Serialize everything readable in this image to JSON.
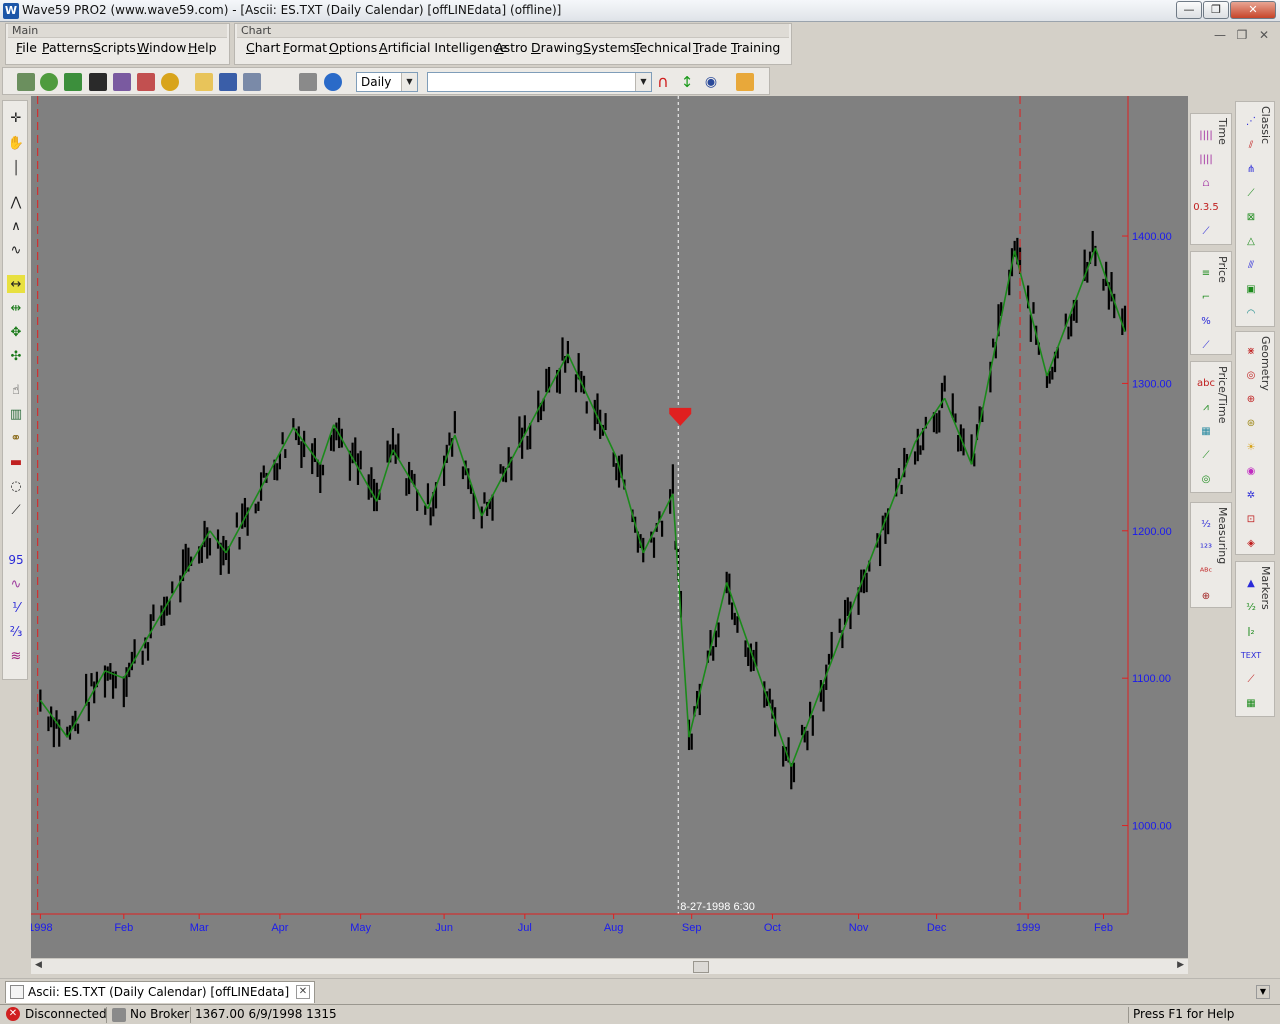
{
  "window": {
    "title": "Wave59 PRO2 (www.wave59.com) - [Ascii: ES.TXT (Daily Calendar) [offLINEdata] (offline)]",
    "app_icon": "W",
    "minimize": "—",
    "maximize": "❐",
    "close": "✕"
  },
  "main_menu": {
    "title": "Main",
    "items": [
      "File",
      "Patterns",
      "Scripts",
      "Window",
      "Help"
    ]
  },
  "chart_menu": {
    "title": "Chart",
    "items": [
      "Chart",
      "Format",
      "Options",
      "Artificial Intelligence",
      "Astro",
      "Drawing",
      "Systems",
      "Technical",
      "Trade",
      "Training"
    ]
  },
  "mdi_controls": {
    "minimize": "—",
    "restore": "❐",
    "close": "✕"
  },
  "toolbar": {
    "timeframe": "Daily",
    "symbol": ""
  },
  "chart_data": {
    "type": "bar",
    "x_tick_labels": [
      "1998",
      "Feb",
      "Mar",
      "Apr",
      "May",
      "Jun",
      "Jul",
      "Aug",
      "Sep",
      "Oct",
      "Nov",
      "Dec",
      "1999",
      "Feb"
    ],
    "y_tick_labels": [
      "1400.00",
      "1300.00",
      "1200.00",
      "1100.00",
      "1000.00"
    ],
    "y_ticks": [
      1400,
      1300,
      1200,
      1100,
      1000
    ],
    "ylim": [
      940,
      1495
    ],
    "crosshair_label": "8-27-1998 6:30",
    "zigzag": [
      [
        "1998-01-02",
        1085
      ],
      [
        "1998-01-12",
        1060
      ],
      [
        "1998-01-26",
        1105
      ],
      [
        "1998-02-02",
        1100
      ],
      [
        "1998-03-06",
        1200
      ],
      [
        "1998-03-12",
        1185
      ],
      [
        "1998-04-06",
        1270
      ],
      [
        "1998-04-16",
        1245
      ],
      [
        "1998-04-21",
        1272
      ],
      [
        "1998-05-07",
        1220
      ],
      [
        "1998-05-13",
        1255
      ],
      [
        "1998-05-26",
        1215
      ],
      [
        "1998-06-05",
        1265
      ],
      [
        "1998-06-15",
        1210
      ],
      [
        "1998-06-30",
        1262
      ],
      [
        "1998-07-17",
        1320
      ],
      [
        "1998-08-04",
        1250
      ],
      [
        "1998-08-14",
        1185
      ],
      [
        "1998-08-25",
        1225
      ],
      [
        "1998-08-31",
        1060
      ],
      [
        "1998-09-14",
        1165
      ],
      [
        "1998-10-08",
        1040
      ],
      [
        "1998-11-23",
        1260
      ],
      [
        "1998-12-04",
        1290
      ],
      [
        "1998-12-14",
        1245
      ],
      [
        "1998-12-30",
        1390
      ],
      [
        "1999-01-11",
        1305
      ],
      [
        "1999-01-29",
        1392
      ],
      [
        "1999-02-09",
        1335
      ]
    ],
    "ohlc_daily_close_approx": "derived",
    "signal_marker": {
      "date": "1998-08-27",
      "price": 1278,
      "color": "#e02020"
    }
  },
  "right_palettes": [
    {
      "title": "Time"
    },
    {
      "title": "Price"
    },
    {
      "title": "Price/Time"
    },
    {
      "title": "Measuring"
    },
    {
      "title": "Classic"
    },
    {
      "title": "Geometry"
    },
    {
      "title": "Markers"
    }
  ],
  "tab": {
    "label": "Ascii: ES.TXT (Daily Calendar) [offLINEdata] (offline)",
    "close": "✕"
  },
  "status": {
    "connection": "Disconnected",
    "broker": "No Broker",
    "quote": "1367.00  6/9/1998  1315",
    "help": "Press F1 for Help"
  },
  "colors": {
    "chart_bg": "#808080",
    "bars": "#000000",
    "zigzag": "#1a8a1a",
    "axis_text": "#1a1aee",
    "axis_line": "#e02020"
  }
}
